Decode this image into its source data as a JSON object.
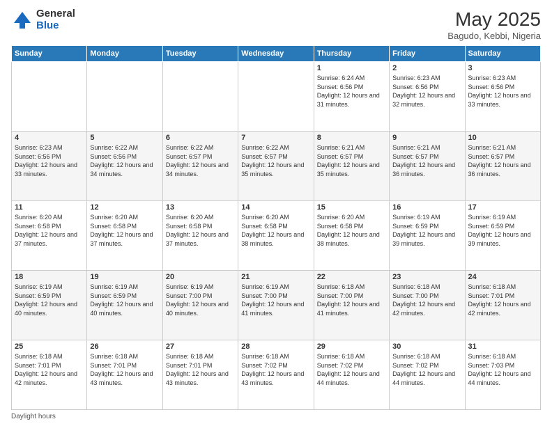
{
  "logo": {
    "general": "General",
    "blue": "Blue"
  },
  "header": {
    "month": "May 2025",
    "location": "Bagudo, Kebbi, Nigeria"
  },
  "days_of_week": [
    "Sunday",
    "Monday",
    "Tuesday",
    "Wednesday",
    "Thursday",
    "Friday",
    "Saturday"
  ],
  "weeks": [
    [
      {
        "day": "",
        "info": ""
      },
      {
        "day": "",
        "info": ""
      },
      {
        "day": "",
        "info": ""
      },
      {
        "day": "",
        "info": ""
      },
      {
        "day": "1",
        "info": "Sunrise: 6:24 AM\nSunset: 6:56 PM\nDaylight: 12 hours\nand 31 minutes."
      },
      {
        "day": "2",
        "info": "Sunrise: 6:23 AM\nSunset: 6:56 PM\nDaylight: 12 hours\nand 32 minutes."
      },
      {
        "day": "3",
        "info": "Sunrise: 6:23 AM\nSunset: 6:56 PM\nDaylight: 12 hours\nand 33 minutes."
      }
    ],
    [
      {
        "day": "4",
        "info": "Sunrise: 6:23 AM\nSunset: 6:56 PM\nDaylight: 12 hours\nand 33 minutes."
      },
      {
        "day": "5",
        "info": "Sunrise: 6:22 AM\nSunset: 6:56 PM\nDaylight: 12 hours\nand 34 minutes."
      },
      {
        "day": "6",
        "info": "Sunrise: 6:22 AM\nSunset: 6:57 PM\nDaylight: 12 hours\nand 34 minutes."
      },
      {
        "day": "7",
        "info": "Sunrise: 6:22 AM\nSunset: 6:57 PM\nDaylight: 12 hours\nand 35 minutes."
      },
      {
        "day": "8",
        "info": "Sunrise: 6:21 AM\nSunset: 6:57 PM\nDaylight: 12 hours\nand 35 minutes."
      },
      {
        "day": "9",
        "info": "Sunrise: 6:21 AM\nSunset: 6:57 PM\nDaylight: 12 hours\nand 36 minutes."
      },
      {
        "day": "10",
        "info": "Sunrise: 6:21 AM\nSunset: 6:57 PM\nDaylight: 12 hours\nand 36 minutes."
      }
    ],
    [
      {
        "day": "11",
        "info": "Sunrise: 6:20 AM\nSunset: 6:58 PM\nDaylight: 12 hours\nand 37 minutes."
      },
      {
        "day": "12",
        "info": "Sunrise: 6:20 AM\nSunset: 6:58 PM\nDaylight: 12 hours\nand 37 minutes."
      },
      {
        "day": "13",
        "info": "Sunrise: 6:20 AM\nSunset: 6:58 PM\nDaylight: 12 hours\nand 37 minutes."
      },
      {
        "day": "14",
        "info": "Sunrise: 6:20 AM\nSunset: 6:58 PM\nDaylight: 12 hours\nand 38 minutes."
      },
      {
        "day": "15",
        "info": "Sunrise: 6:20 AM\nSunset: 6:58 PM\nDaylight: 12 hours\nand 38 minutes."
      },
      {
        "day": "16",
        "info": "Sunrise: 6:19 AM\nSunset: 6:59 PM\nDaylight: 12 hours\nand 39 minutes."
      },
      {
        "day": "17",
        "info": "Sunrise: 6:19 AM\nSunset: 6:59 PM\nDaylight: 12 hours\nand 39 minutes."
      }
    ],
    [
      {
        "day": "18",
        "info": "Sunrise: 6:19 AM\nSunset: 6:59 PM\nDaylight: 12 hours\nand 40 minutes."
      },
      {
        "day": "19",
        "info": "Sunrise: 6:19 AM\nSunset: 6:59 PM\nDaylight: 12 hours\nand 40 minutes."
      },
      {
        "day": "20",
        "info": "Sunrise: 6:19 AM\nSunset: 7:00 PM\nDaylight: 12 hours\nand 40 minutes."
      },
      {
        "day": "21",
        "info": "Sunrise: 6:19 AM\nSunset: 7:00 PM\nDaylight: 12 hours\nand 41 minutes."
      },
      {
        "day": "22",
        "info": "Sunrise: 6:18 AM\nSunset: 7:00 PM\nDaylight: 12 hours\nand 41 minutes."
      },
      {
        "day": "23",
        "info": "Sunrise: 6:18 AM\nSunset: 7:00 PM\nDaylight: 12 hours\nand 42 minutes."
      },
      {
        "day": "24",
        "info": "Sunrise: 6:18 AM\nSunset: 7:01 PM\nDaylight: 12 hours\nand 42 minutes."
      }
    ],
    [
      {
        "day": "25",
        "info": "Sunrise: 6:18 AM\nSunset: 7:01 PM\nDaylight: 12 hours\nand 42 minutes."
      },
      {
        "day": "26",
        "info": "Sunrise: 6:18 AM\nSunset: 7:01 PM\nDaylight: 12 hours\nand 43 minutes."
      },
      {
        "day": "27",
        "info": "Sunrise: 6:18 AM\nSunset: 7:01 PM\nDaylight: 12 hours\nand 43 minutes."
      },
      {
        "day": "28",
        "info": "Sunrise: 6:18 AM\nSunset: 7:02 PM\nDaylight: 12 hours\nand 43 minutes."
      },
      {
        "day": "29",
        "info": "Sunrise: 6:18 AM\nSunset: 7:02 PM\nDaylight: 12 hours\nand 44 minutes."
      },
      {
        "day": "30",
        "info": "Sunrise: 6:18 AM\nSunset: 7:02 PM\nDaylight: 12 hours\nand 44 minutes."
      },
      {
        "day": "31",
        "info": "Sunrise: 6:18 AM\nSunset: 7:03 PM\nDaylight: 12 hours\nand 44 minutes."
      }
    ]
  ],
  "footer": {
    "label": "Daylight hours"
  }
}
